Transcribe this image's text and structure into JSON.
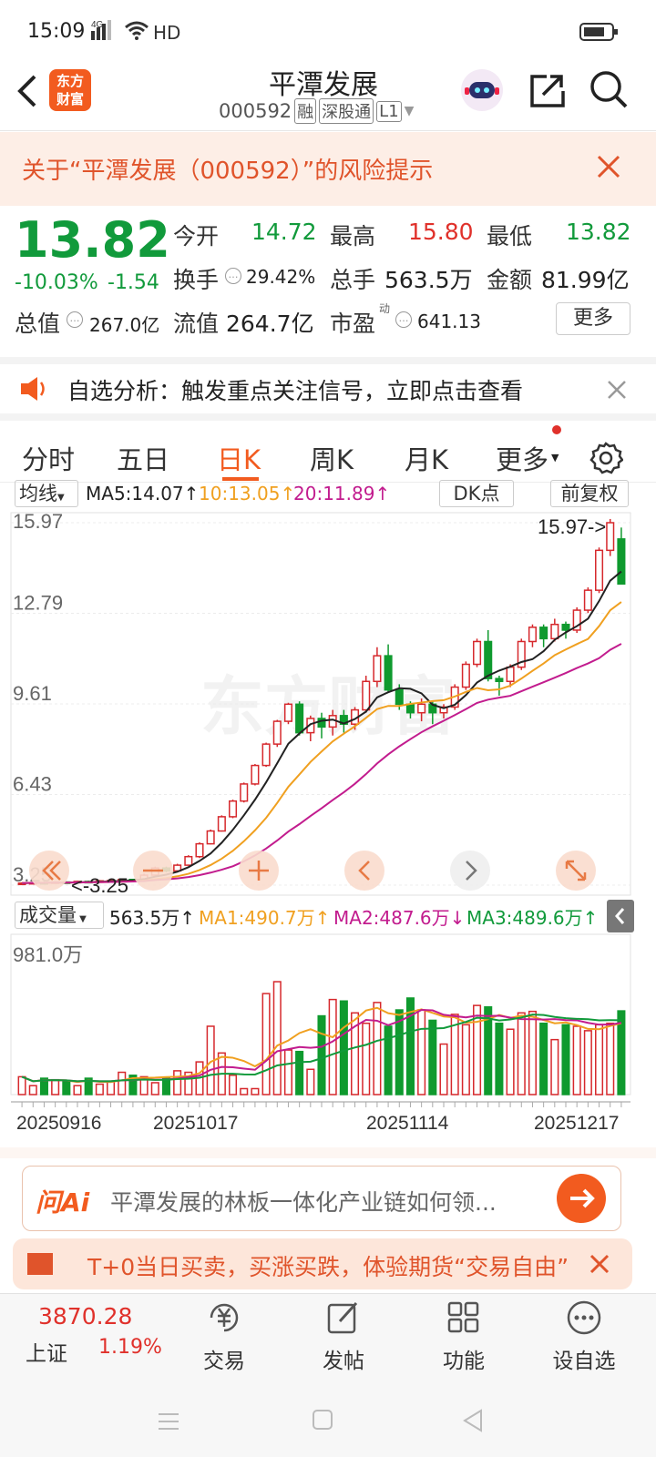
{
  "status": {
    "time": "15:09",
    "signal": "4G",
    "hd": "HD"
  },
  "header": {
    "logo_line1": "东方",
    "logo_line2": "财富",
    "name": "平潭发展",
    "code": "000592",
    "tags": [
      "融",
      "深股通",
      "L1"
    ]
  },
  "risk": {
    "text": "关于“平潭发展（000592）”的风险提示"
  },
  "quote": {
    "price": "13.82",
    "pct": "-10.03%",
    "chg": "-1.54",
    "open_label": "今开",
    "open": "14.72",
    "high_label": "最高",
    "high": "15.80",
    "low_label": "最低",
    "low": "13.82",
    "turnover_label": "换手",
    "turnover": "29.42%",
    "volume_label": "总手",
    "volume": "563.5万",
    "amount_label": "金额",
    "amount": "81.99亿",
    "mcap_label": "总值",
    "mcap": "267.0亿",
    "float_label": "流值",
    "float": "264.7亿",
    "pe_label": "市盈",
    "pe_sup": "动",
    "pe": "641.13",
    "more": "更多"
  },
  "notice": {
    "text": "自选分析：触发重点关注信号，立即点击查看"
  },
  "tabs": [
    "分时",
    "五日",
    "日K",
    "周K",
    "月K",
    "更多"
  ],
  "active_tab": "日K",
  "kline": {
    "ma_select": "均线",
    "ma5": "MA5:14.07↑",
    "ma10": "10:13.05↑",
    "ma20": "20:11.89↑",
    "dk": "DK点",
    "adj": "前复权",
    "y_ticks": [
      "15.97",
      "12.79",
      "9.61",
      "6.43",
      "3.25"
    ],
    "max_label": "15.97->",
    "min_label": "<-3.25",
    "watermark": "东方财富",
    "colors": {
      "up": "#d6282c",
      "down": "#0f9a2e",
      "ma5": "#222222",
      "ma10": "#f0a020",
      "ma20": "#c21c8e"
    }
  },
  "volume": {
    "select": "成交量",
    "value": "563.5万↑",
    "ma1": "MA1:490.7万↑",
    "ma2": "MA2:487.6万↓",
    "ma3": "MA3:489.6万↑",
    "y_top": "981.0万",
    "x_labels": [
      "20250916",
      "20251017",
      "20251114",
      "20251217"
    ]
  },
  "ai": {
    "logo": "问Ai",
    "prompt": "平潭发展的林板一体化产业链如何领...",
    "banner": "T+0当日买卖，买涨买跌，体验期货“交易自由”"
  },
  "bottom_nav": {
    "index_value": "3870.28",
    "index_name": "上证",
    "index_pct": "1.19%",
    "items": [
      "交易",
      "发帖",
      "功能",
      "设自选"
    ]
  },
  "chart_data": {
    "type": "candlestick",
    "y_range": [
      3.25,
      15.97
    ],
    "candles": [
      [
        3.3,
        3.32,
        3.28,
        3.35
      ],
      [
        3.32,
        3.34,
        3.3,
        3.36
      ],
      [
        3.34,
        3.33,
        3.31,
        3.37
      ],
      [
        3.33,
        3.36,
        3.32,
        3.38
      ],
      [
        3.36,
        3.34,
        3.33,
        3.38
      ],
      [
        3.34,
        3.38,
        3.33,
        3.4
      ],
      [
        3.38,
        3.37,
        3.35,
        3.41
      ],
      [
        3.37,
        3.4,
        3.36,
        3.43
      ],
      [
        3.4,
        3.41,
        3.38,
        3.45
      ],
      [
        3.41,
        3.45,
        3.4,
        3.48
      ],
      [
        3.45,
        3.44,
        3.42,
        3.47
      ],
      [
        3.44,
        3.6,
        3.43,
        3.65
      ],
      [
        3.6,
        3.85,
        3.58,
        3.9
      ],
      [
        3.85,
        3.75,
        3.7,
        3.9
      ],
      [
        3.75,
        3.95,
        3.72,
        4.0
      ],
      [
        3.95,
        4.25,
        3.93,
        4.3
      ],
      [
        4.25,
        4.7,
        4.2,
        4.75
      ],
      [
        4.7,
        5.15,
        4.68,
        5.2
      ],
      [
        5.15,
        5.65,
        5.13,
        5.7
      ],
      [
        5.65,
        6.2,
        5.6,
        6.25
      ],
      [
        6.2,
        6.8,
        6.15,
        6.85
      ],
      [
        6.8,
        7.45,
        6.75,
        7.5
      ],
      [
        7.45,
        8.2,
        7.4,
        8.25
      ],
      [
        8.2,
        9.0,
        8.1,
        9.05
      ],
      [
        9.0,
        9.6,
        8.9,
        9.65
      ],
      [
        9.6,
        8.6,
        8.5,
        9.7
      ],
      [
        8.6,
        9.1,
        8.3,
        9.2
      ],
      [
        9.1,
        8.8,
        8.4,
        9.3
      ],
      [
        8.8,
        9.2,
        8.5,
        9.4
      ],
      [
        9.2,
        8.9,
        8.6,
        9.4
      ],
      [
        8.9,
        9.4,
        8.7,
        9.5
      ],
      [
        9.4,
        10.4,
        9.3,
        10.6
      ],
      [
        10.4,
        11.3,
        10.2,
        11.6
      ],
      [
        11.3,
        10.1,
        10.0,
        11.7
      ],
      [
        10.1,
        9.6,
        9.4,
        10.3
      ],
      [
        9.6,
        9.3,
        9.1,
        9.7
      ],
      [
        9.3,
        9.6,
        9.0,
        9.8
      ],
      [
        9.6,
        9.3,
        8.9,
        9.7
      ],
      [
        9.3,
        9.5,
        9.1,
        9.6
      ],
      [
        9.5,
        10.2,
        9.4,
        10.3
      ],
      [
        10.2,
        11.0,
        10.1,
        11.1
      ],
      [
        11.0,
        11.8,
        10.9,
        11.9
      ],
      [
        11.8,
        10.5,
        10.4,
        12.2
      ],
      [
        10.5,
        10.4,
        9.9,
        10.6
      ],
      [
        10.4,
        10.9,
        10.2,
        11.0
      ],
      [
        10.9,
        11.8,
        10.8,
        11.9
      ],
      [
        11.8,
        12.3,
        11.6,
        12.4
      ],
      [
        12.3,
        11.9,
        11.6,
        12.4
      ],
      [
        11.9,
        12.4,
        11.8,
        12.6
      ],
      [
        12.4,
        12.2,
        11.9,
        12.5
      ],
      [
        12.2,
        12.9,
        12.1,
        13.0
      ],
      [
        12.9,
        13.6,
        12.8,
        13.7
      ],
      [
        13.6,
        15.0,
        13.5,
        15.1
      ],
      [
        15.0,
        15.97,
        14.8,
        16.1
      ],
      [
        15.4,
        13.82,
        13.82,
        15.8
      ]
    ],
    "volumes": [
      120,
      60,
      110,
      100,
      90,
      60,
      110,
      70,
      90,
      150,
      130,
      120,
      80,
      110,
      160,
      150,
      220,
      460,
      280,
      130,
      40,
      40,
      680,
      760,
      300,
      290,
      170,
      530,
      640,
      630,
      550,
      480,
      620,
      460,
      570,
      650,
      570,
      500,
      340,
      540,
      470,
      600,
      590,
      480,
      440,
      550,
      560,
      480,
      370,
      470,
      460,
      430,
      470,
      480,
      563.5
    ]
  }
}
